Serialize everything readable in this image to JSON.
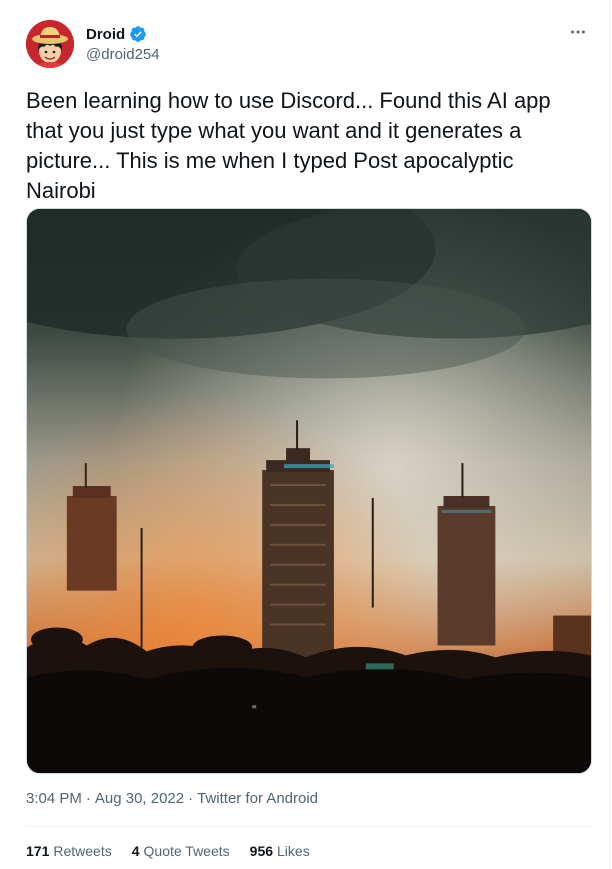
{
  "author": {
    "display_name": "Droid",
    "handle": "@droid254",
    "verified": true,
    "avatar_icon": "straw-hat-avatar"
  },
  "tweet": {
    "text": "Been learning how to use Discord... Found this AI app that you just type what you want and it generates a picture... This is me when I typed Post apocalyptic Nairobi"
  },
  "media": {
    "kind": "ai-generated-image",
    "icon": "apocalyptic-city-skyline-image"
  },
  "meta": {
    "time": "3:04 PM",
    "separator": "·",
    "date": "Aug 30, 2022",
    "source": "Twitter for Android"
  },
  "stats": {
    "retweets": {
      "count": "171",
      "label": "Retweets"
    },
    "quotes": {
      "count": "4",
      "label": "Quote Tweets"
    },
    "likes": {
      "count": "956",
      "label": "Likes"
    }
  },
  "colors": {
    "text_primary": "#0f1419",
    "text_secondary": "#536471",
    "verified_blue": "#1d9bf0",
    "divider": "#eff3f4"
  }
}
